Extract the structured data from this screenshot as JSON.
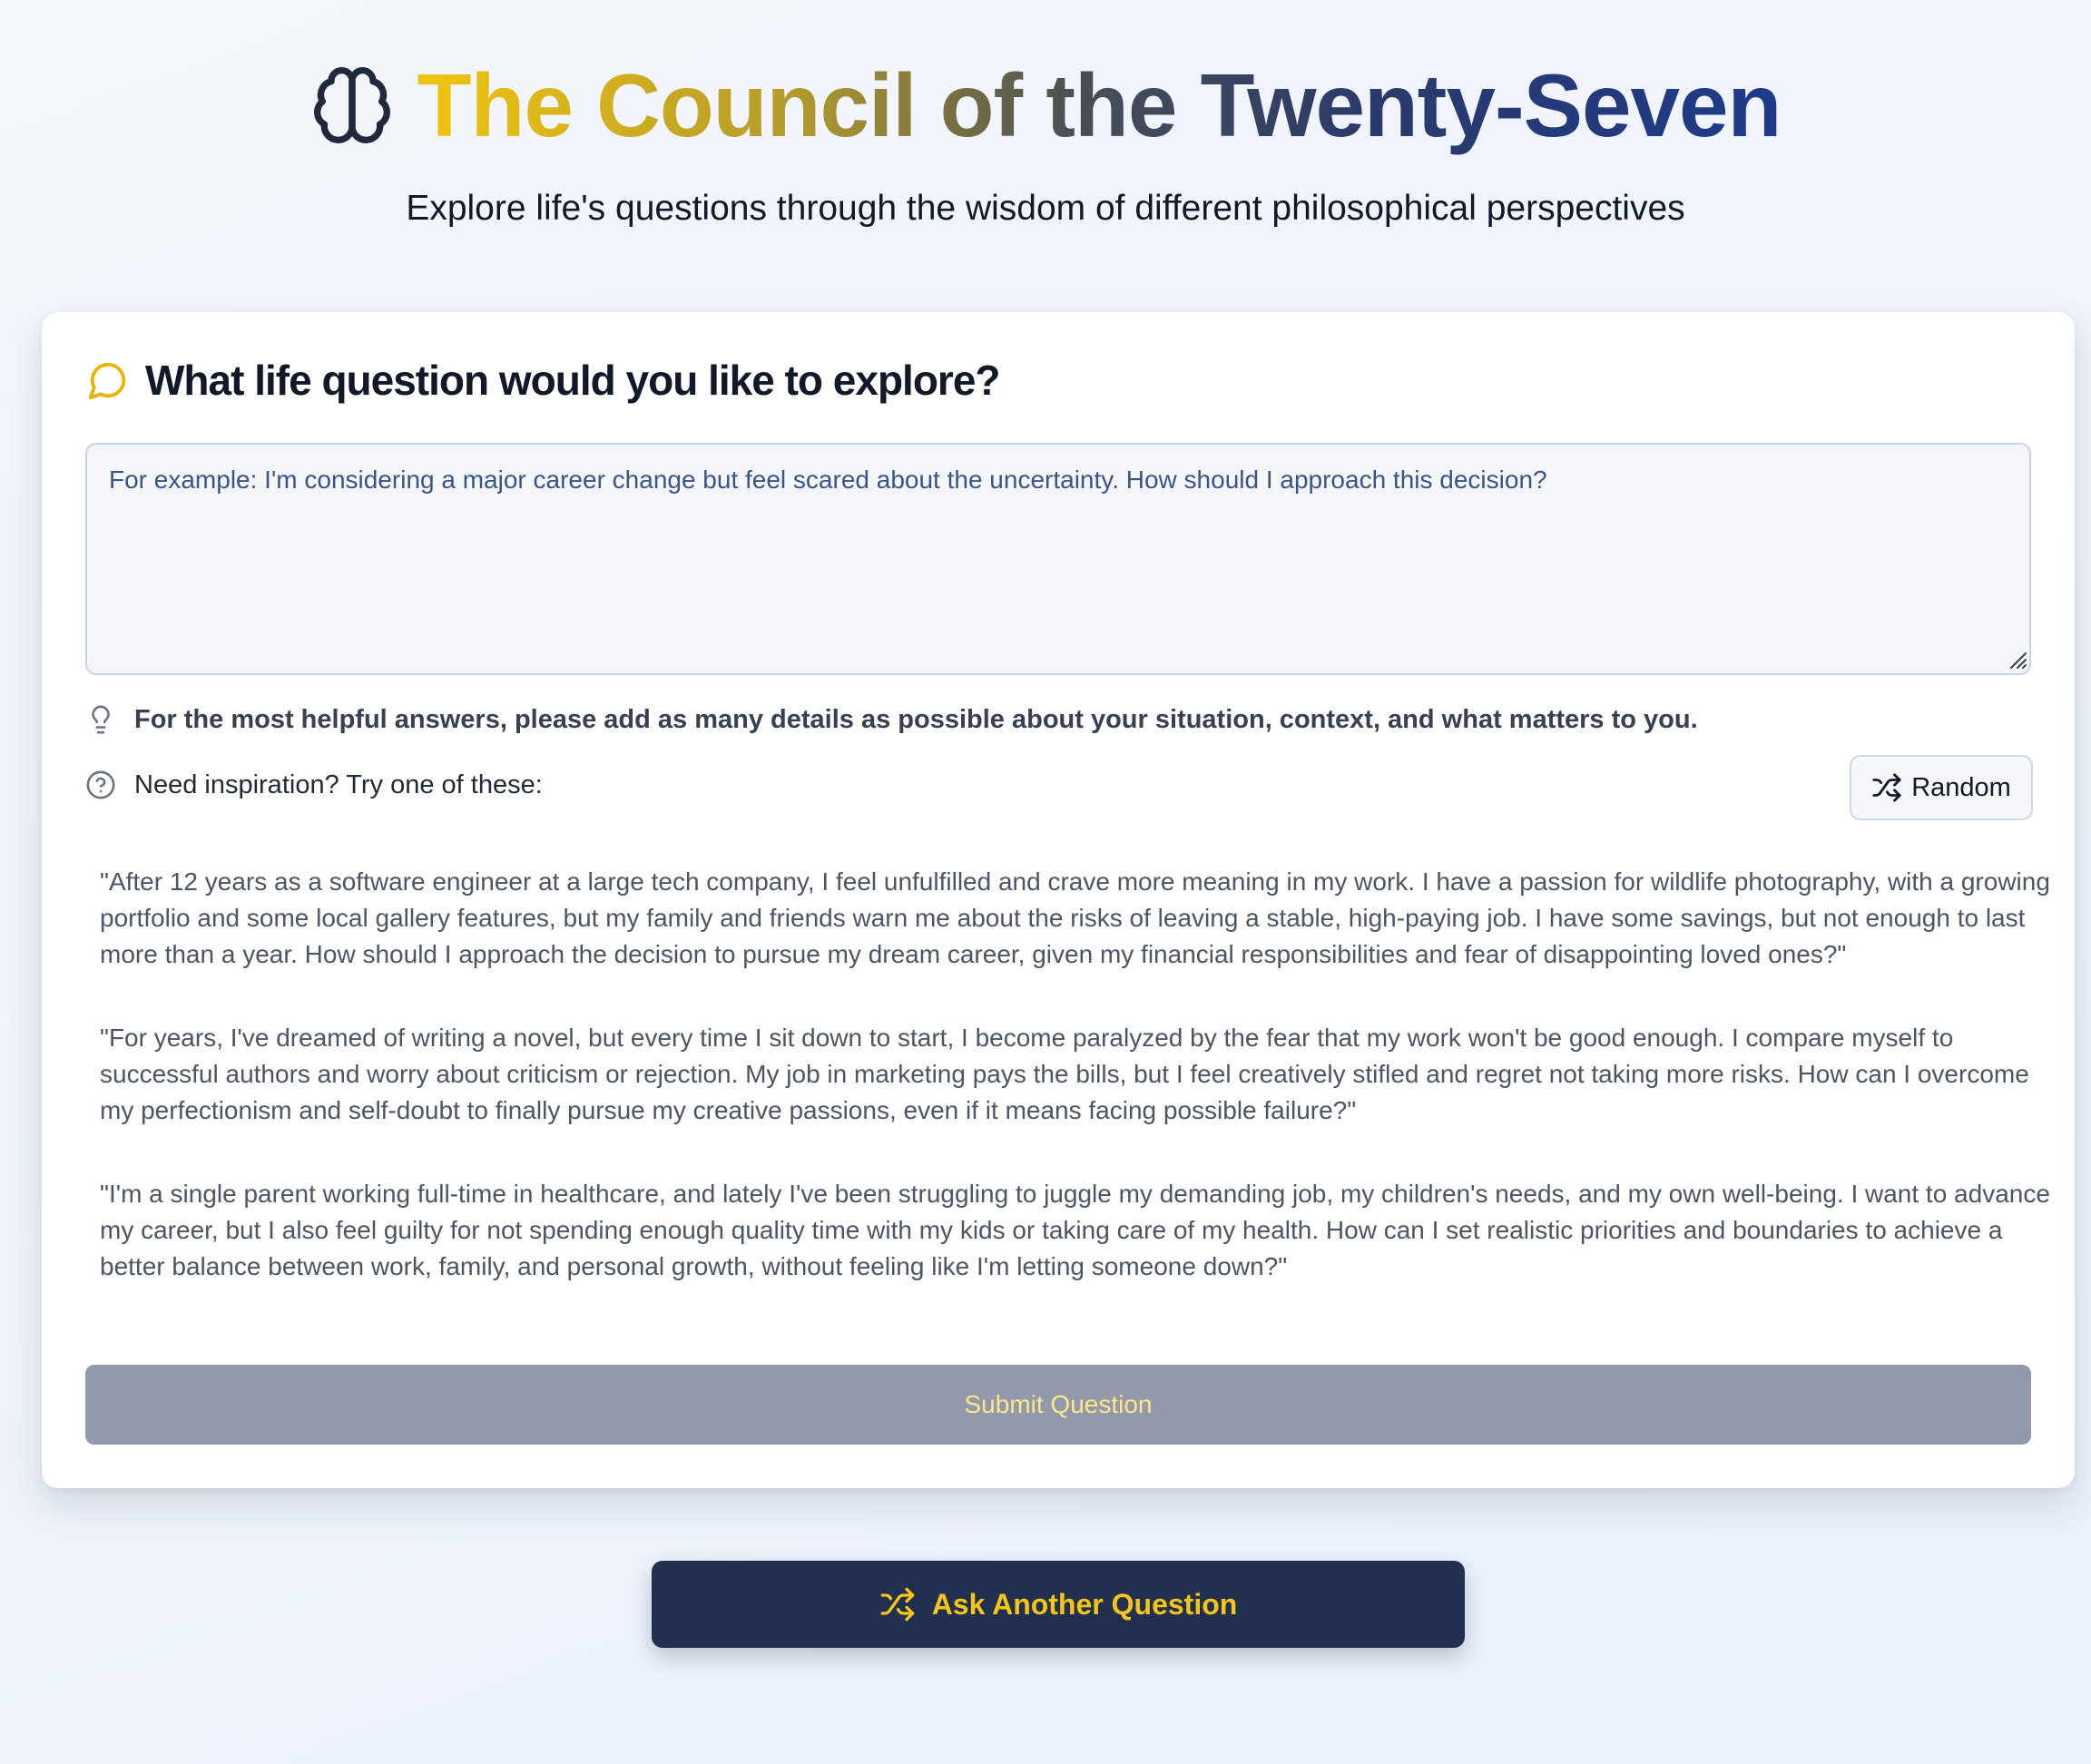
{
  "header": {
    "title": "The Council of the Twenty-Seven",
    "subtitle": "Explore life's questions through the wisdom of different philosophical perspectives",
    "icon": "brain-icon"
  },
  "question_card": {
    "heading": "What life question would you like to explore?",
    "heading_icon": "chat-bubble-icon",
    "textarea": {
      "value": "",
      "placeholder": "For example: I'm considering a major career change but feel scared about the uncertainty. How should I approach this decision?"
    },
    "hint": "For the most helpful answers, please add as many details as possible about your situation, context, and what matters to you.",
    "hint_icon": "lightbulb-icon",
    "inspiration_label": "Need inspiration? Try one of these:",
    "inspiration_icon": "help-circle-icon",
    "random_button": "Random",
    "examples": [
      "\"After 12 years as a software engineer at a large tech company, I feel unfulfilled and crave more meaning in my work. I have a passion for wildlife photography, with a growing portfolio and some local gallery features, but my family and friends warn me about the risks of leaving a stable, high-paying job. I have some savings, but not enough to last more than a year. How should I approach the decision to pursue my dream career, given my financial responsibilities and fear of disappointing loved ones?\"",
      "\"For years, I've dreamed of writing a novel, but every time I sit down to start, I become paralyzed by the fear that my work won't be good enough. I compare myself to successful authors and worry about criticism or rejection. My job in marketing pays the bills, but I feel creatively stifled and regret not taking more risks. How can I overcome my perfectionism and self-doubt to finally pursue my creative passions, even if it means facing possible failure?\"",
      "\"I'm a single parent working full-time in healthcare, and lately I've been struggling to juggle my demanding job, my children's needs, and my own well-being. I want to advance my career, but I also feel guilty for not spending enough quality time with my kids or taking care of my health. How can I set realistic priorities and boundaries to achieve a better balance between work, family, and personal growth, without feeling like I'm letting someone down?\""
    ],
    "submit_button": "Submit Question"
  },
  "ask_another": {
    "label": "Ask Another Question",
    "icon": "shuffle-icon"
  },
  "colors": {
    "navy": "#22304f",
    "gold": "#f5c518",
    "title_gradient": [
      "#f1c40f",
      "#4a4f55",
      "#1e3a8a"
    ],
    "submit_disabled": "#9199aa"
  }
}
